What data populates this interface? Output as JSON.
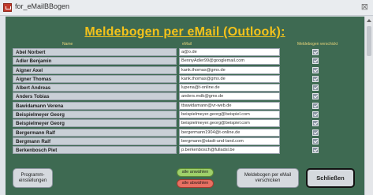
{
  "window": {
    "title": "for_eMailBBogen",
    "close_glyph": "⊠"
  },
  "form": {
    "heading": "Meldebogen per eMail (Outlook):",
    "columns": {
      "name": "Name",
      "email": "eMail",
      "sent": "Meldebogen verschickt"
    }
  },
  "rows": [
    {
      "name": "Abel Norbert",
      "email": "a@o.de",
      "sent": true
    },
    {
      "name": "Adler Benjamin",
      "email": "BennyAdler99@googlemail.com",
      "sent": true
    },
    {
      "name": "Aigner Axel",
      "email": "kank.thomas@gmx.de",
      "sent": true
    },
    {
      "name": "Aigner Thomas",
      "email": "kank.thomas@gmx.de",
      "sent": true
    },
    {
      "name": "Albert Andreas",
      "email": "lupena@t-online.de",
      "sent": true
    },
    {
      "name": "Anders Tobias",
      "email": "anders.mdk@gmx.de",
      "sent": true
    },
    {
      "name": "Bawidamann Verena",
      "email": "tbawidamann@vr-web.de",
      "sent": true
    },
    {
      "name": "Beispielmeyer Georg",
      "email": "beispielmeyer.georg@beispiel.com",
      "sent": true
    },
    {
      "name": "Beispielmeyer Georg",
      "email": "beispielmeyer.georg@beispiel.com",
      "sent": true
    },
    {
      "name": "Bergermann Ralf",
      "email": "bergermann1904@t-online.de",
      "sent": true
    },
    {
      "name": "Bergmann Ralf",
      "email": "bergmann@stadt-und-land.com",
      "sent": true
    },
    {
      "name": "Berkenbosch Piet",
      "email": "p.berkenbosch@fulladsl.be",
      "sent": true
    }
  ],
  "buttons": {
    "program_settings": "Programm-\neinstellungen",
    "select_all": "alle anwählen",
    "deselect_all": "alle abwählen",
    "send": "Meldebogen per eMail\nverschicken",
    "close": "Schließen"
  },
  "colors": {
    "form_bg": "#3e6a52",
    "heading": "#f3c21b",
    "select_all": "#9fd06a",
    "deselect_all": "#e77062"
  }
}
